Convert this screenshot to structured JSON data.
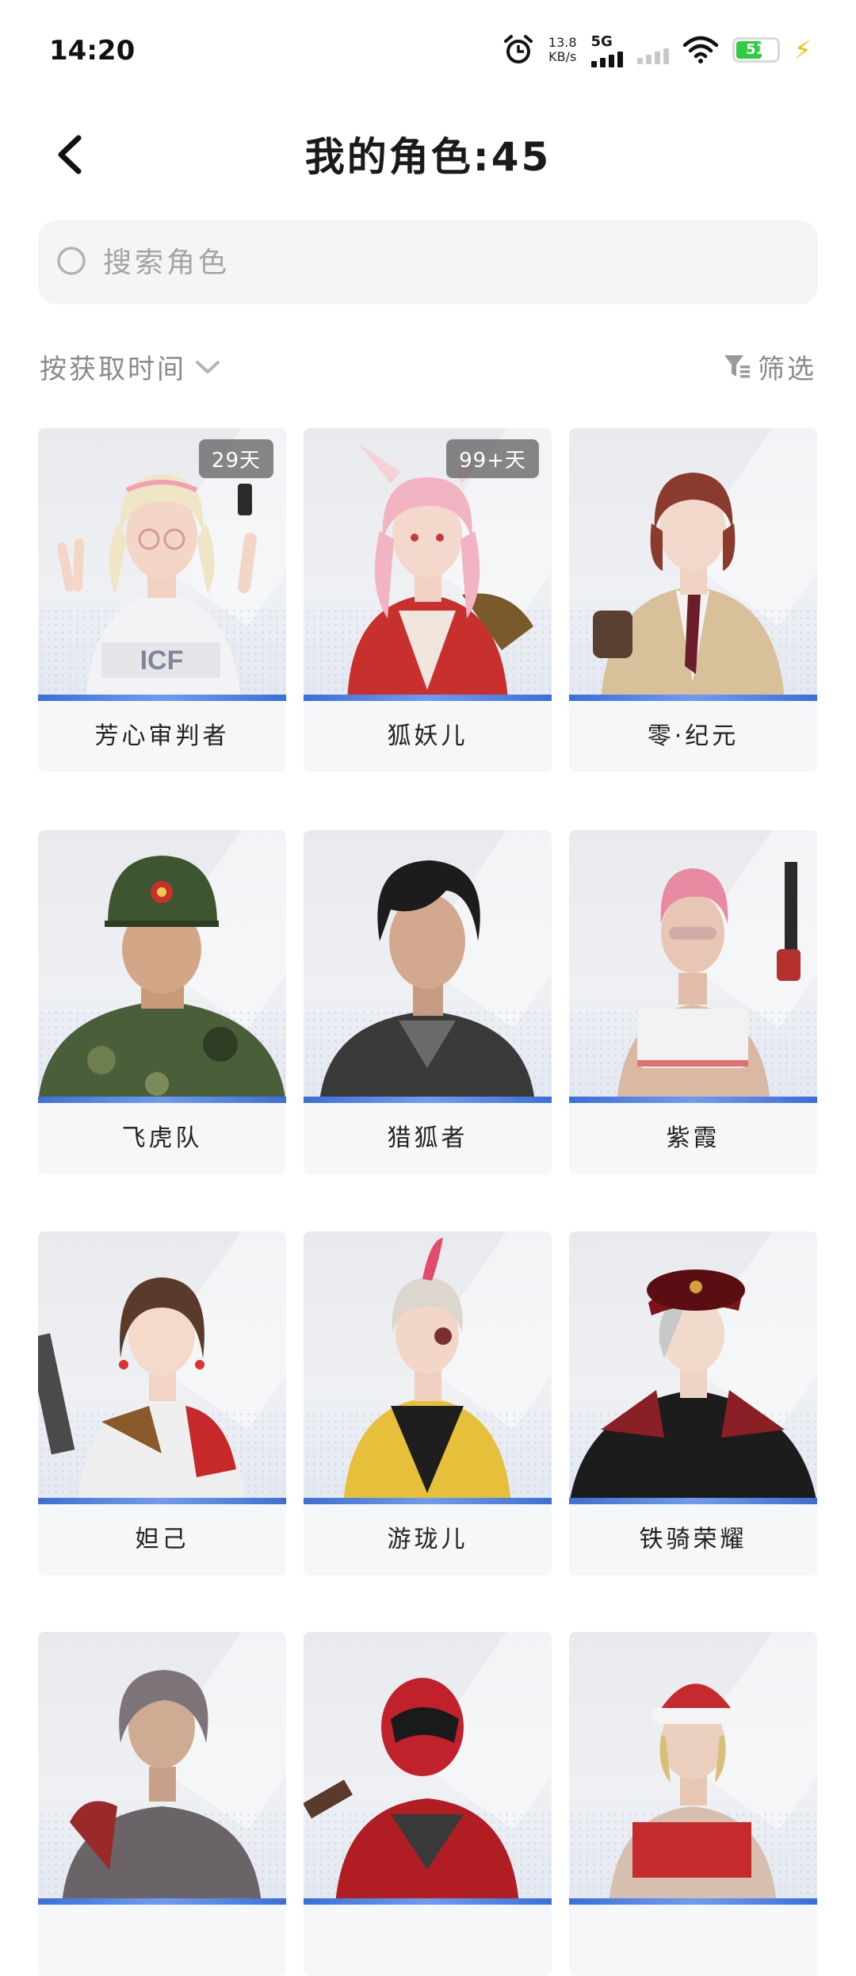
{
  "status_bar": {
    "time": "14:20",
    "speed_value": "13.8",
    "speed_unit": "KB/s",
    "network": "5G",
    "battery": "51"
  },
  "header": {
    "title": "我的角色:45"
  },
  "search": {
    "placeholder": "搜索角色"
  },
  "sort": {
    "label": "按获取时间"
  },
  "filter": {
    "label": "筛选"
  },
  "characters": [
    {
      "name": "芳心审判者",
      "badge": "29天"
    },
    {
      "name": "狐妖儿",
      "badge": "99+天"
    },
    {
      "name": "零·纪元",
      "badge": ""
    },
    {
      "name": "飞虎队",
      "badge": ""
    },
    {
      "name": "猎狐者",
      "badge": ""
    },
    {
      "name": "紫霞",
      "badge": ""
    },
    {
      "name": "妲己",
      "badge": ""
    },
    {
      "name": "游珑儿",
      "badge": ""
    },
    {
      "name": "铁骑荣耀",
      "badge": ""
    },
    {
      "name": "",
      "badge": ""
    },
    {
      "name": "",
      "badge": ""
    },
    {
      "name": "",
      "badge": ""
    }
  ]
}
